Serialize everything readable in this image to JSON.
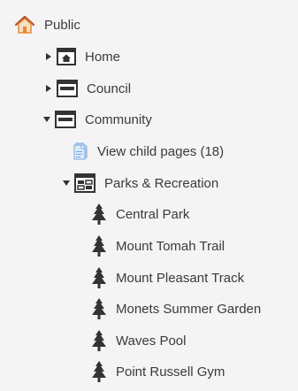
{
  "tree": {
    "root": {
      "label": "Public",
      "icon": "house-icon"
    },
    "items": [
      {
        "label": "Home",
        "icon": "home-page-icon",
        "state": "collapsed"
      },
      {
        "label": "Council",
        "icon": "page-icon",
        "state": "collapsed"
      },
      {
        "label": "Community",
        "icon": "page-icon",
        "state": "expanded"
      },
      {
        "label": "View child pages (18)",
        "icon": "child-pages-icon"
      },
      {
        "label": "Parks & Recreation",
        "icon": "section-page-icon",
        "state": "expanded"
      },
      {
        "label": "Central Park",
        "icon": "tree-icon"
      },
      {
        "label": "Mount Tomah Trail",
        "icon": "tree-icon"
      },
      {
        "label": "Mount Pleasant Track",
        "icon": "tree-icon"
      },
      {
        "label": "Monets Summer Garden",
        "icon": "tree-icon"
      },
      {
        "label": "Waves Pool",
        "icon": "tree-icon"
      },
      {
        "label": "Point Russell Gym",
        "icon": "tree-icon"
      }
    ]
  },
  "colors": {
    "background": "#f4f4f4",
    "text": "#3a3a3a",
    "icon_dark": "#333333",
    "house_orange": "#e8892b",
    "house_roof": "#c0392b",
    "child_pages_blue": "#7aa7e0"
  }
}
